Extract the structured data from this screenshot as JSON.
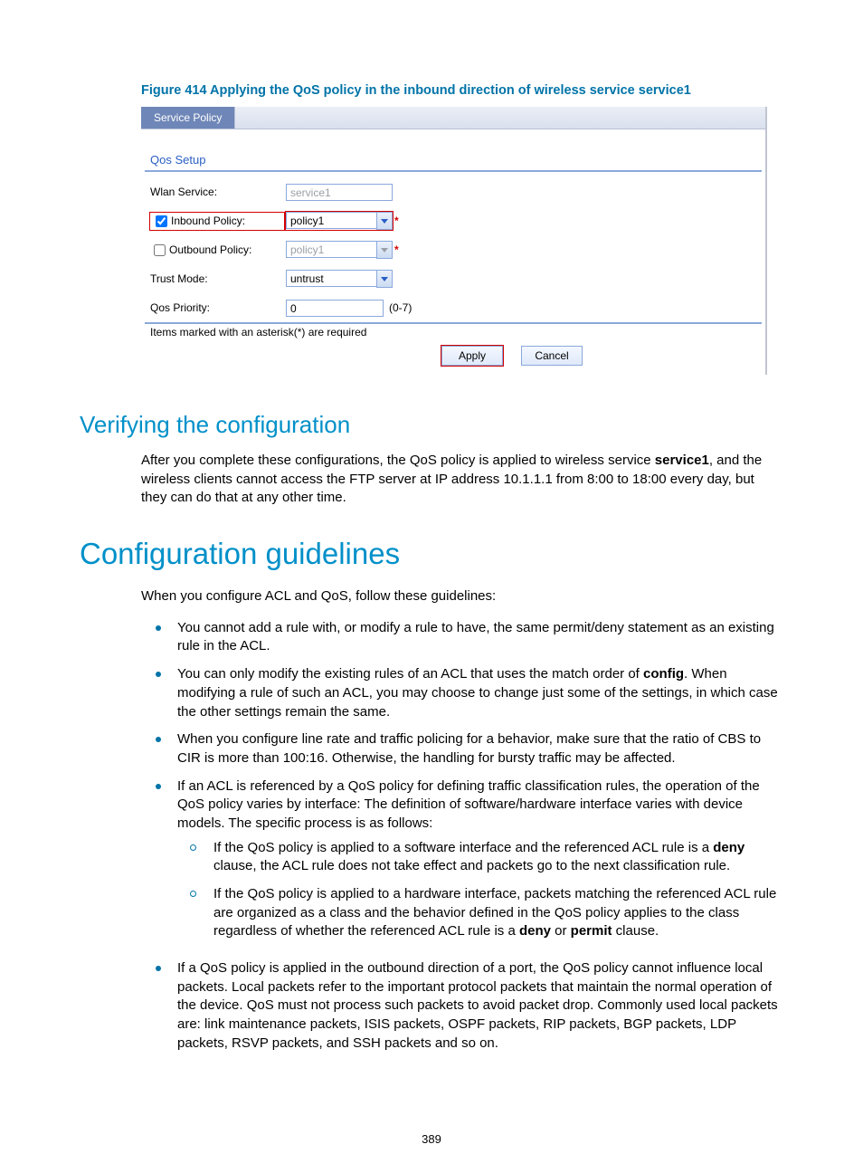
{
  "figure_caption": "Figure 414 Applying the QoS policy in the inbound direction of wireless service service1",
  "screenshot": {
    "tab": "Service Policy",
    "section_title": "Qos Setup",
    "rows": {
      "wlan_service": {
        "label": "Wlan Service:",
        "value": "service1"
      },
      "inbound": {
        "label": "Inbound Policy:",
        "value": "policy1",
        "checked": true
      },
      "outbound": {
        "label": "Outbound Policy:",
        "value": "policy1",
        "checked": false
      },
      "trust": {
        "label": "Trust Mode:",
        "value": "untrust"
      },
      "priority": {
        "label": "Qos Priority:",
        "value": "0",
        "range": "(0-7)"
      }
    },
    "note": "Items marked with an asterisk(*) are required",
    "buttons": {
      "apply": "Apply",
      "cancel": "Cancel"
    }
  },
  "h2_verify": "Verifying the configuration",
  "verify_para": "After you complete these configurations, the QoS policy is applied to wireless service <b>service1</b>, and the wireless clients cannot access the FTP server at IP address 10.1.1.1 from 8:00 to 18:00 every day, but they can do that at any other time.",
  "h1_guidelines": "Configuration guidelines",
  "guidelines_intro": "When you configure ACL and QoS, follow these guidelines:",
  "bullets": [
    "You cannot add a rule with, or modify a rule to have, the same permit/deny statement as an existing rule in the ACL.",
    "You can only modify the existing rules of an ACL that uses the match order of <b>config</b>. When modifying a rule of such an ACL, you may choose to change just some of the settings, in which case the other settings remain the same.",
    "When you configure line rate and traffic policing for a behavior, make sure that the ratio of CBS to CIR is more than 100:16. Otherwise, the handling for bursty traffic may be affected.",
    "If an ACL is referenced by a QoS policy for defining traffic classification rules, the operation of the QoS policy varies by interface: The definition of software/hardware interface varies with device models. The specific process is as follows:",
    "If a QoS policy is applied in the outbound direction of a port, the QoS policy cannot influence local packets. Local packets refer to the important protocol packets that maintain the normal operation of the device. QoS must not process such packets to avoid packet drop. Commonly used local packets are: link maintenance packets, ISIS packets, OSPF packets, RIP packets, BGP packets, LDP packets, RSVP packets, and SSH packets and so on."
  ],
  "sub_bullets": [
    "If the QoS policy is applied to a software interface and the referenced ACL rule is a <b>deny</b> clause, the ACL rule does not take effect and packets go to the next classification rule.",
    "If the QoS policy is applied to a hardware interface, packets matching the referenced ACL rule are organized as a class and the behavior defined in the QoS policy applies to the class regardless of whether the referenced ACL rule is a <b>deny</b> or <b>permit</b> clause."
  ],
  "page_number": "389"
}
